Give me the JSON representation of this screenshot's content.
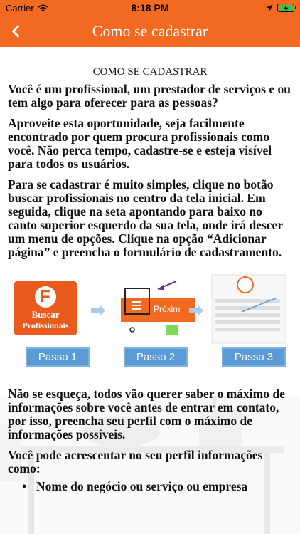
{
  "status": {
    "carrier": "Carrier",
    "time": "8:18 PM"
  },
  "header": {
    "title": "Como se cadastrar"
  },
  "section_heading": "COMO SE CADASTRAR",
  "paragraphs": [
    "Você é um profissional, um prestador de serviços e ou tem algo para oferecer para as pessoas?",
    "Aproveite esta oportunidade, seja facilmente encontrado por quem procura profissionais como você. Não perca tempo, cadastre-se e esteja visível para todos os usuários.",
    "Para se cadastrar é muito simples, clique no botão buscar profissionais no centro da tela inicial. Em seguida, clique na seta apontando para baixo no canto superior esquerdo da sua tela, onde irá descer um menu de opções. Clique na opção “Adicionar página” e preencha o formulário de cadastramento.",
    "Não se esqueça, todos vão querer saber o máximo de informações sobre você antes de entrar em contato, por isso, preencha seu perfil com o máximo de informações possíveis.",
    "Você pode acrescentar no seu perfil informações como:"
  ],
  "steps": {
    "logo_letter": "F",
    "buscar_line1": "Buscar",
    "buscar_line2": "Profissionais",
    "proximo": "Próxim",
    "labels": [
      "Passo 1",
      "Passo 2",
      "Passo 3"
    ]
  },
  "bullets": [
    "Nome do negócio ou serviço ou empresa"
  ],
  "colors": {
    "brand": "#f26a22",
    "step_blue": "#5b9bd5"
  }
}
